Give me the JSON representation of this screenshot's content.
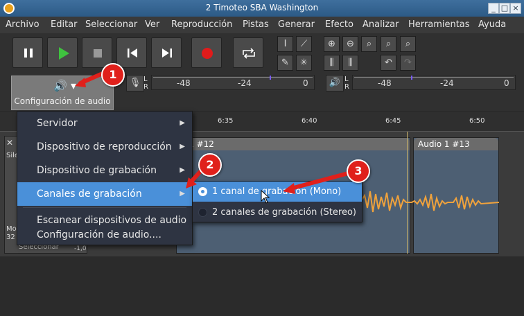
{
  "window": {
    "title": "2 Timoteo SBA Washington",
    "controls": [
      "_",
      "□",
      "×"
    ]
  },
  "menubar": {
    "items": [
      "Archivo",
      "Editar",
      "Seleccionar",
      "Ver",
      "Reproducción",
      "Pistas",
      "Generar",
      "Efecto",
      "Analizar",
      "Herramientas",
      "Ayuda"
    ]
  },
  "transport": {
    "buttons": [
      "pause-icon",
      "play-icon",
      "stop-icon",
      "skip-start-icon",
      "skip-end-icon",
      "record-icon",
      "loop-icon"
    ],
    "play_color": "#3fc23f",
    "record_color": "#e01b1b"
  },
  "meters": {
    "record": {
      "lr": [
        "L",
        "R"
      ],
      "ticks": [
        "-48",
        "-24",
        "0"
      ]
    },
    "play": {
      "lr": [
        "L",
        "R"
      ],
      "ticks": [
        "-48",
        "-24",
        "0"
      ]
    }
  },
  "audio_setup": {
    "label": "Configuración de audio"
  },
  "ruler": {
    "labels": [
      "6:35",
      "6:40",
      "6:45",
      "6:50"
    ]
  },
  "tracks": {
    "panel_labels": [
      "Sile",
      "Mo",
      "32",
      "Seleccionar",
      "-1,0"
    ],
    "clip1_title": "o 1 #12",
    "clip2_title": "Audio 1 #13",
    "wave_color": "#f0a23c"
  },
  "menu1": {
    "items": [
      {
        "label": "Servidor",
        "submenu": true
      },
      {
        "label": "Dispositivo de reproducción",
        "submenu": true
      },
      {
        "label": "Dispositivo de grabación",
        "submenu": true
      },
      {
        "label": "Canales de grabación",
        "submenu": true,
        "selected": true
      },
      {
        "label": "Escanear dispositivos de audio",
        "submenu": false
      },
      {
        "label": "Configuración de audio....",
        "submenu": false
      }
    ]
  },
  "menu2": {
    "items": [
      {
        "label": "1 canal de grabación (Mono)",
        "checked": true
      },
      {
        "label": "2 canales de grabación (Stereo)",
        "checked": false
      }
    ]
  },
  "callouts": [
    "1",
    "2",
    "3"
  ],
  "accent": "#4a90d9",
  "callout_color": "#e0201b"
}
